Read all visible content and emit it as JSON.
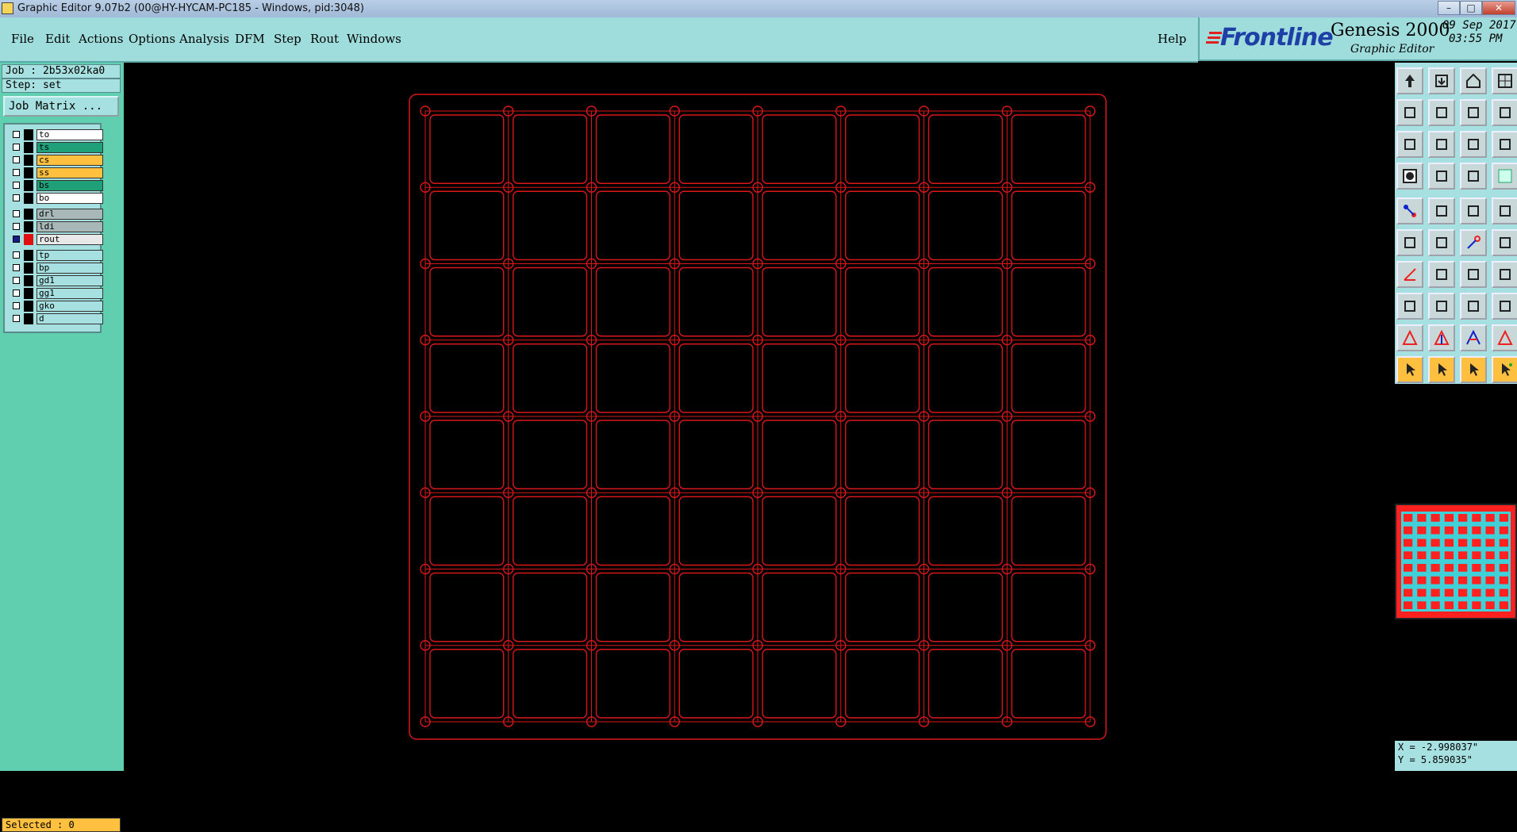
{
  "window": {
    "title": "Graphic Editor 9.07b2 (00@HY-HYCAM-PC185 - Windows, pid:3048)",
    "controls": {
      "minimize": "–",
      "maximize": "□",
      "close": "✕"
    }
  },
  "menu": {
    "items": [
      "File",
      "Edit",
      "Actions",
      "Options",
      "Analysis",
      "DFM",
      "Step",
      "Rout",
      "Windows"
    ],
    "help": "Help"
  },
  "brand": {
    "logo": "Frontline",
    "product": "Genesis 2000",
    "subtitle": "Graphic Editor",
    "date": "09 Sep 2017",
    "time": "03:55 PM"
  },
  "job": {
    "job_line": "Job : 2b53x02ka0",
    "step_line": "Step: set",
    "matrix_button": "Job Matrix ..."
  },
  "layers": [
    {
      "name": "to",
      "color": "#ffffff",
      "checked": false,
      "active": false
    },
    {
      "name": "ts",
      "color": "#1fa078",
      "checked": false,
      "active": false
    },
    {
      "name": "cs",
      "color": "#ffc040",
      "checked": false,
      "active": false
    },
    {
      "name": "ss",
      "color": "#ffc040",
      "checked": false,
      "active": false
    },
    {
      "name": "bs",
      "color": "#1fa078",
      "checked": false,
      "active": false
    },
    {
      "name": "bo",
      "color": "#ffffff",
      "checked": false,
      "active": false
    },
    {
      "name": "drl",
      "color": "#a8b8b8",
      "checked": false,
      "active": false
    },
    {
      "name": "ldi",
      "color": "#a8b8b8",
      "checked": false,
      "active": false
    },
    {
      "name": "rout",
      "color": "#e8e8e8",
      "checked": true,
      "active": true
    },
    {
      "name": "tp",
      "color": "#a7e0e0",
      "checked": false,
      "active": false
    },
    {
      "name": "bp",
      "color": "#a7e0e0",
      "checked": false,
      "active": false
    },
    {
      "name": "gd1",
      "color": "#a7e0e0",
      "checked": false,
      "active": false
    },
    {
      "name": "gg1",
      "color": "#a7e0e0",
      "checked": false,
      "active": false
    },
    {
      "name": "gko",
      "color": "#a7e0e0",
      "checked": false,
      "active": false
    },
    {
      "name": "d",
      "color": "#a7e0e0",
      "checked": false,
      "active": false
    }
  ],
  "status": {
    "selected": "Selected : 0",
    "x": "X = -2.998037\"",
    "y": "Y = 5.859035\""
  },
  "panel": {
    "rows": 8,
    "cols": 8,
    "line_color": "#d81818"
  },
  "tools": [
    "upload-icon",
    "save-icon",
    "home-icon",
    "split-window-icon",
    "prev-icon",
    "next-icon",
    "swap-icon",
    "scroll-icon",
    "fit-icon",
    "zoom-icon",
    "scale-icon",
    "help-icon",
    "feature-icon",
    "grid-icon",
    "layers-on-icon",
    "layers-off-icon",
    "snap-center-icon",
    "snap-skeleton-icon",
    "ruler-icon",
    "pad-icon",
    "connect-icon",
    "cross-icon",
    "point-red-icon",
    "point-dot-icon",
    "angle-icon",
    "line-icon",
    "arc-icon",
    "text-icon",
    "pin-icon",
    "dash-icon",
    "measure-icon",
    "copper-icon",
    "triangle-a-icon",
    "triangle-b-icon",
    "triangle-c-icon",
    "triangle-d-icon",
    "select-pointer-icon",
    "select-box-icon",
    "select-lasso-icon",
    "select-net-icon"
  ]
}
